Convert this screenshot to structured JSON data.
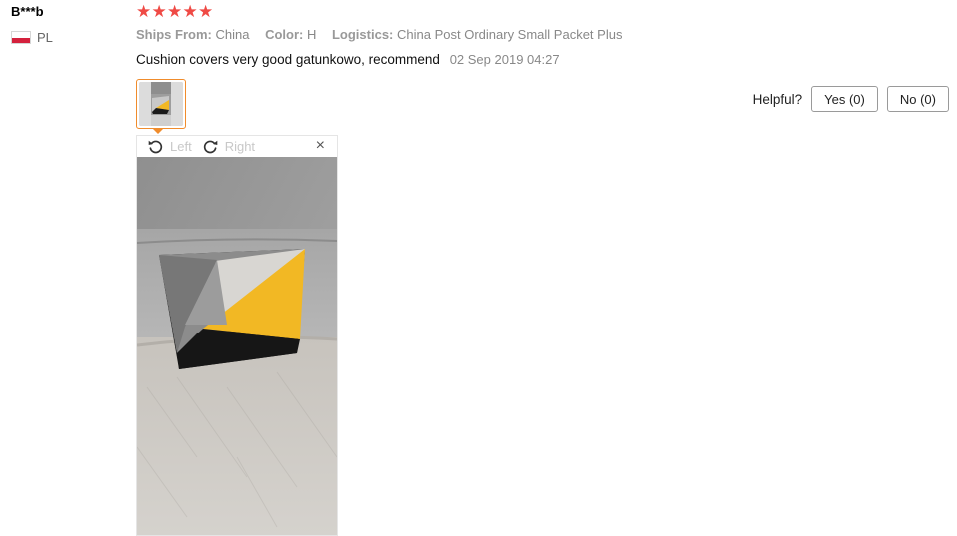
{
  "reviewer": {
    "name": "B***b",
    "country_code": "PL",
    "flag_icon": "poland-flag-icon"
  },
  "rating": {
    "stars": 5,
    "max": 5,
    "color": "#ef4a45"
  },
  "details": {
    "ships_from_label": "Ships From:",
    "ships_from_value": "China",
    "color_label": "Color:",
    "color_value": "H",
    "logistics_label": "Logistics:",
    "logistics_value": "China Post Ordinary Small Packet Plus"
  },
  "review": {
    "text": "Cushion covers very good gatunkowo, recommend",
    "date": "02 Sep 2019 04:27"
  },
  "helpful": {
    "label": "Helpful?",
    "yes_label": "Yes (0)",
    "no_label": "No (0)"
  },
  "viewer": {
    "rotate_left_label": "Left",
    "rotate_left_icon": "rotate-left-icon",
    "rotate_right_label": "Right",
    "rotate_right_icon": "rotate-right-icon",
    "close_label": "×",
    "close_icon": "close-icon"
  },
  "colors": {
    "thumb_border": "#f08c2c",
    "cushion_yellow": "#f2b824"
  }
}
